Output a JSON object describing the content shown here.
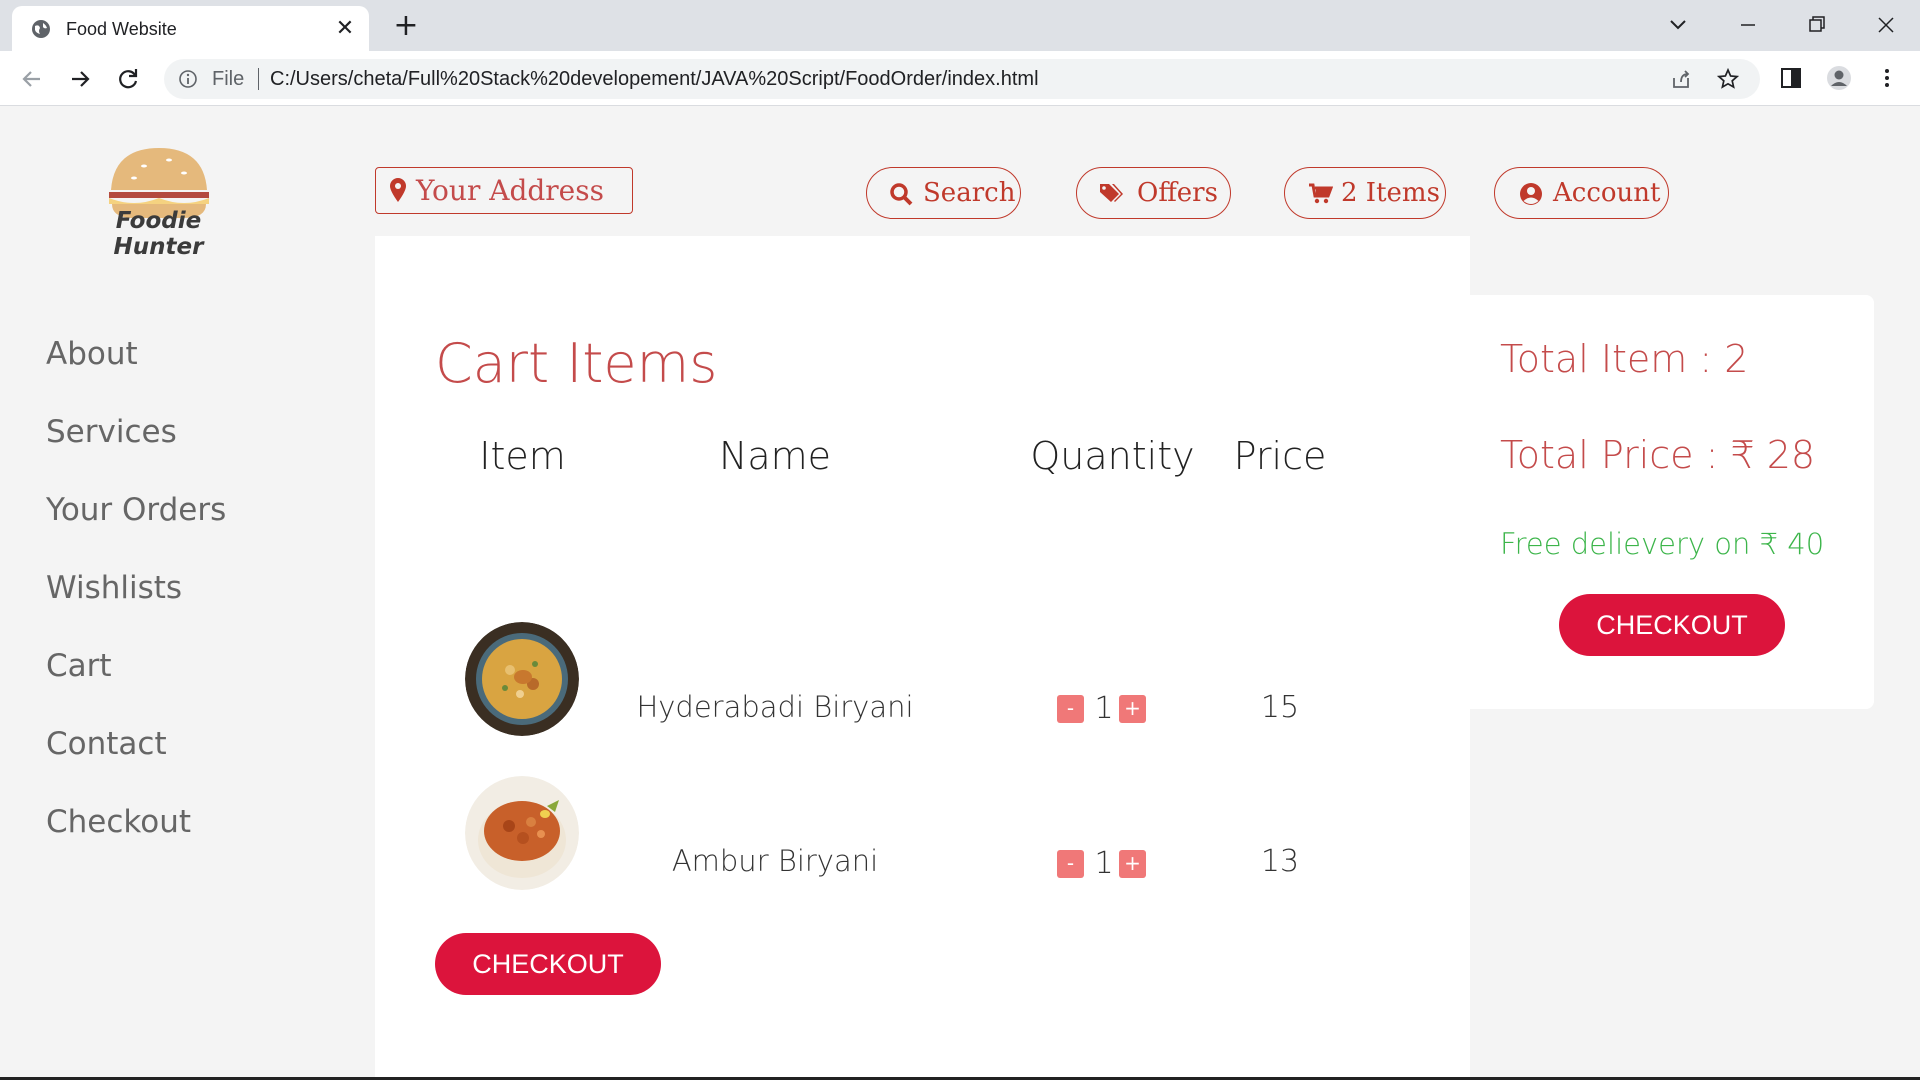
{
  "browser": {
    "tab_title": "Food Website",
    "file_label": "File",
    "url": "C:/Users/cheta/Full%20Stack%20developement/JAVA%20Script/FoodOrder/index.html"
  },
  "brand": {
    "name": "Foodie Hunter"
  },
  "sidebar": {
    "items": [
      {
        "label": "About"
      },
      {
        "label": "Services"
      },
      {
        "label": "Your Orders"
      },
      {
        "label": "Wishlists"
      },
      {
        "label": "Cart"
      },
      {
        "label": "Contact"
      },
      {
        "label": "Checkout"
      }
    ]
  },
  "header": {
    "address_placeholder": "Your Address",
    "search_label": "Search",
    "offers_label": "Offers",
    "cart_label": "2 Items",
    "account_label": "Account"
  },
  "cart": {
    "title": "Cart Items",
    "columns": [
      "Item",
      "Name",
      "Quantity",
      "Price"
    ],
    "rows": [
      {
        "name": "Hyderabadi Biryani",
        "qty": "1",
        "price": "15",
        "minus": "-",
        "plus": "+"
      },
      {
        "name": "Ambur Biryani",
        "qty": "1",
        "price": "13",
        "minus": "-",
        "plus": "+"
      }
    ],
    "checkout_label": "CHECKOUT"
  },
  "summary": {
    "total_items": "Total Item : 2",
    "total_price": "Total Price : ₹ 28",
    "free_delivery": "Free delievery on ₹ 40",
    "checkout_label": "CHECKOUT"
  },
  "colors": {
    "accent": "#c0392b",
    "checkout": "#dc143c",
    "free_delivery": "#3cb54a",
    "qty_button": "#f07878"
  }
}
